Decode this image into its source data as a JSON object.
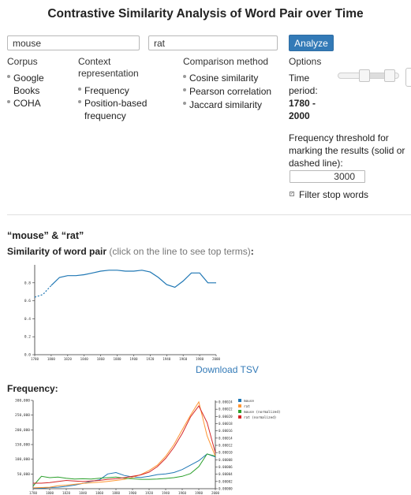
{
  "title": "Contrastive Similarity Analysis of Word Pair over Time",
  "inputs": {
    "word1": "mouse",
    "word2": "rat"
  },
  "analyze_label": "Analyze",
  "corpus": {
    "label": "Corpus",
    "options": [
      "Google Books",
      "COHA"
    ],
    "selected": "Google Books"
  },
  "context": {
    "label": "Context representation",
    "options": [
      "Frequency",
      "Position-based frequency"
    ]
  },
  "comparison": {
    "label": "Comparison method",
    "options": [
      "Cosine similarity",
      "Pearson correlation",
      "Jaccard similarity"
    ],
    "selected": "Cosine similarity"
  },
  "options": {
    "label": "Options",
    "time_period_label": "Time period:",
    "time_period_value": "1780 - 2000",
    "threshold_label": "Frequency threshold for marking the results (solid or dashed line):",
    "threshold_value": "3000",
    "filter_label": "Filter stop words",
    "filter_checked": true
  },
  "result": {
    "pair_title": "“mouse” & “rat”",
    "similarity_label": "Similarity of word pair",
    "similarity_hint": "(click on the line to see top terms)",
    "download_label": "Download TSV",
    "frequency_label": "Frequency:"
  },
  "colors": {
    "accent": "#337ab7",
    "mouse": "#1f77b4",
    "rat": "#ff9633",
    "mouse_norm": "#2ca02c",
    "rat_norm": "#d62728"
  },
  "chart_data": [
    {
      "type": "line",
      "x": [
        1780,
        1790,
        1800,
        1810,
        1820,
        1830,
        1840,
        1850,
        1860,
        1870,
        1880,
        1890,
        1900,
        1910,
        1920,
        1930,
        1940,
        1950,
        1960,
        1970,
        1980,
        1990,
        2000
      ],
      "series": [
        {
          "values": [
            0.64,
            0.67,
            0.77,
            0.86,
            0.88,
            0.88,
            0.89,
            0.91,
            0.93,
            0.94,
            0.94,
            0.93,
            0.93,
            0.94,
            0.92,
            0.86,
            0.78,
            0.75,
            0.82,
            0.91,
            0.91,
            0.8,
            0.8
          ]
        }
      ],
      "x_ticks": [
        "1780",
        "1800",
        "1820",
        "1840",
        "1860",
        "1880",
        "1900",
        "1920",
        "1940",
        "1960",
        "1980",
        "2000"
      ],
      "y_ticks": [
        "0.0",
        "0.2",
        "0.4",
        "0.6",
        "0.8"
      ],
      "xlim": [
        1780,
        2000
      ],
      "ylim": [
        0,
        1.0
      ],
      "solid_from": 1800
    },
    {
      "type": "line",
      "x": [
        1780,
        1790,
        1800,
        1810,
        1820,
        1830,
        1840,
        1850,
        1860,
        1870,
        1880,
        1890,
        1900,
        1910,
        1920,
        1930,
        1940,
        1950,
        1960,
        1970,
        1980,
        1990,
        2000
      ],
      "series": [
        {
          "name": "mouse",
          "axis": "left",
          "values": [
            2000,
            1500,
            4000,
            5000,
            8000,
            12000,
            18000,
            25000,
            30000,
            50000,
            55000,
            45000,
            40000,
            38000,
            42000,
            48000,
            50000,
            55000,
            65000,
            80000,
            95000,
            118000,
            108000
          ]
        },
        {
          "name": "rat",
          "axis": "left",
          "values": [
            3000,
            4000,
            5000,
            10000,
            12000,
            15000,
            18000,
            20000,
            22000,
            25000,
            28000,
            32000,
            38000,
            48000,
            62000,
            80000,
            110000,
            150000,
            200000,
            250000,
            295000,
            180000,
            110000
          ]
        },
        {
          "name": "mouse (normalized)",
          "axis": "right",
          "values": [
            1e-06,
            4.5e-06,
            4e-06,
            4.2e-06,
            3.8e-06,
            3.5e-06,
            3.6e-06,
            3.5e-06,
            3.8e-06,
            4e-06,
            4.2e-06,
            3.8e-06,
            3.6e-06,
            3.4e-06,
            3.4e-06,
            3.5e-06,
            3.7e-06,
            4e-06,
            4.5e-06,
            5.5e-06,
            8e-06,
            1.26e-05,
            1.18e-05
          ]
        },
        {
          "name": "rat (normalized)",
          "axis": "right",
          "values": [
            2e-06,
            2e-06,
            2.2e-06,
            2.6e-06,
            3e-06,
            2.8e-06,
            2.6e-06,
            2.8e-06,
            3e-06,
            3.4e-06,
            3.6e-06,
            4e-06,
            4.5e-06,
            5e-06,
            6e-06,
            8e-06,
            1.1e-05,
            1.5e-05,
            2e-05,
            2.6e-05,
            3e-05,
            2.4e-05,
            1.3e-05
          ]
        }
      ],
      "x_ticks": [
        "1780",
        "1800",
        "1820",
        "1840",
        "1860",
        "1880",
        "1900",
        "1920",
        "1940",
        "1960",
        "1980",
        "2000"
      ],
      "y_ticks_left": [
        "50,000",
        "100,000",
        "150,000",
        "200,000",
        "250,000",
        "300,000"
      ],
      "y_ticks_right": [
        "0.00000",
        "0.00002",
        "0.00004",
        "0.00006",
        "0.00008",
        "0.00010",
        "0.00012",
        "0.00014",
        "0.00016",
        "0.00018",
        "0.00020",
        "0.00022",
        "0.00024"
      ],
      "xlim": [
        1780,
        2000
      ],
      "ylim_left": [
        0,
        300000
      ],
      "ylim_right": [
        0,
        3.2e-05
      ],
      "legend": [
        "mouse",
        "rat",
        "mouse (normalized)",
        "rat (normalized)"
      ],
      "legend_position": "right"
    }
  ]
}
